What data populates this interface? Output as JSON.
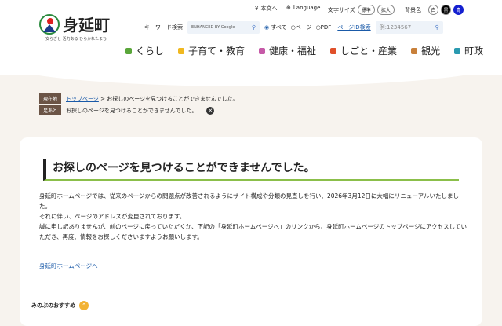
{
  "header": {
    "site_name": "身延町",
    "tagline": "安らぎと 活力ある ひらかれたまち",
    "skip": "本文へ",
    "language": "Language",
    "font_size_label": "文字サイズ",
    "font_standard": "標準",
    "font_large": "拡大",
    "bg_label": "背景色",
    "bg_white": "白",
    "bg_black": "黒",
    "bg_blue": "青",
    "keyword_label": "キーワード検索",
    "google_placeholder": "ENHANCED BY Google",
    "radio_all": "すべて",
    "radio_page": "ページ",
    "radio_pdf": "PDF",
    "page_id_link": "ページID検索",
    "page_id_placeholder": "例:1234567"
  },
  "nav": [
    {
      "label": "くらし",
      "color": "#5aa63a"
    },
    {
      "label": "子育て・教育",
      "color": "#f0b820"
    },
    {
      "label": "健康・福祉",
      "color": "#c65aa8"
    },
    {
      "label": "しごと・産業",
      "color": "#e0502a"
    },
    {
      "label": "観光",
      "color": "#c8803a"
    },
    {
      "label": "町政",
      "color": "#2a9ab0"
    }
  ],
  "breadcrumb": {
    "current_tag": "現在地",
    "top_link": "トップページ",
    "sep": ">",
    "current": "お探しのページを見つけることができませんでした。",
    "history_tag": "足あと",
    "history_item": "お探しのページを見つけることができませんでした。"
  },
  "main": {
    "title": "お探しのページを見つけることができませんでした。",
    "paragraphs": [
      "身延町ホームページでは、従来のページからの問題点が改善されるようにサイト構成や分類の見直しを行い、2026年3月12日に大幅にリニューアルいたしました。",
      "それに伴い、ページのアドレスが変更されております。",
      "誠に申し訳ありませんが、前のページに戻っていただくか、下記の「身延町ホームページへ」のリンクから、身延町ホームページのトップページにアクセスしていただき、再度、情報をお探しくださいますようお願いします。"
    ],
    "home_link": "身延町ホームページへ"
  },
  "recommend": {
    "label": "みのぶのおすすめ"
  }
}
